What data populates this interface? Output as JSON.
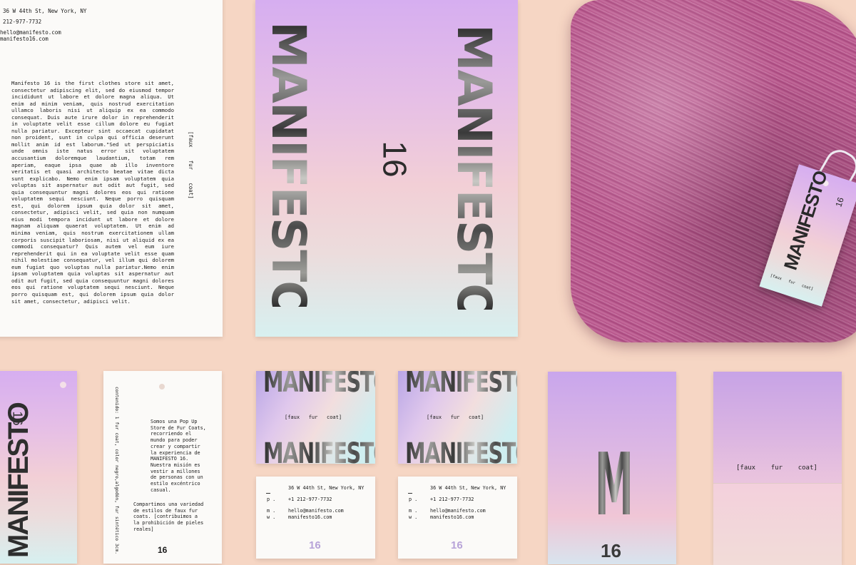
{
  "letterhead": {
    "address": "36 W 44th St, New York, NY",
    "phone": "212-977-7732",
    "email": "hello@manifesto.com",
    "web": "manifesto16.com",
    "body": "Manifesto 16 is the first clothes store sit amet, consectetur adipiscing elit, sed do eiusmod tempor incididunt ut labore et dolore magna aliqua. Ut enim ad minim veniam, quis nostrud exercitation ullamco laboris nisi ut aliquip ex ea commodo consequat. Duis aute irure dolor in reprehenderit in voluptate velit esse cillum dolore eu fugiat nulla pariatur. Excepteur sint occaecat cupidatat non proident, sunt in culpa qui officia deserunt mollit anim id est laborum.\"Sed ut perspiciatis unde omnis iste natus error sit voluptatem accusantium doloremque laudantium, totam rem aperiam, eaque ipsa quae ab illo inventore veritatis et quasi architecto beatae vitae dicta sunt explicabo. Nemo enim ipsam voluptatem quia voluptas sit aspernatur aut odit aut fugit, sed quia consequuntur magni dolores eos qui ratione voluptatem sequi nesciunt. Neque porro quisquam est, qui dolorem ipsum quia dolor sit amet, consectetur, adipisci velit, sed quia non numquam eius modi tempora incidunt ut labore et dolore magnam aliquam quaerat voluptatem. Ut enim ad minima veniam, quis nostrum exercitationem ullam corporis suscipit laboriosam, nisi ut aliquid ex ea commodi consequatur? Quis autem vel eum iure reprehenderit qui in ea voluptate velit esse quam nihil molestiae consequatur, vel illum qui dolorem eum fugiat quo voluptas nulla pariatur.Nemo enim ipsam voluptatem quia voluptas sit aspernatur aut odit aut fugit, sed quia consequuntur magni dolores eos qui ratione voluptatem sequi nesciunt. Neque porro quisquam est, qui dolorem ipsum quia dolor sit amet, consectetur, adipisci velit.",
    "tagline": "[faux    fur    coat]"
  },
  "poster": {
    "word": "MANIFESTO",
    "number": "16"
  },
  "hangtag": {
    "word": "MANIFESTO",
    "number": "16",
    "tagline": "[faux   fur   coat]"
  },
  "back_tag": {
    "side_text": "contenido: 1 fur coat, color negro,algodón, fur sintético 3cm.",
    "para1": "Somos una Pop Up Store de Fur Coats, recorriendo el mundo para poder crear y compartir la experiencia de MANIFESTO 16. Nuestra misión es vestir a millones de personas con un estilo excéntrico casual.",
    "para2": "Compartimos una variedad de estilos de faux fur coats. [contribuimos a la prohibición de pieles reales]",
    "number": "16"
  },
  "cards": {
    "word": "MANIFESTO",
    "tagline": "[faux   fur   coat]",
    "address": "36 W 44th St, New York, NY",
    "p_label": "p .",
    "phone": "+1 212-977-7732",
    "m_label": "m .",
    "w_label": "w .",
    "email": "hello@manifesto.com",
    "web": "manifesto16.com",
    "number": "16"
  },
  "tall_card": {
    "letter": "M",
    "number": "16"
  },
  "folder": {
    "tagline": "[faux    fur    coat]"
  }
}
